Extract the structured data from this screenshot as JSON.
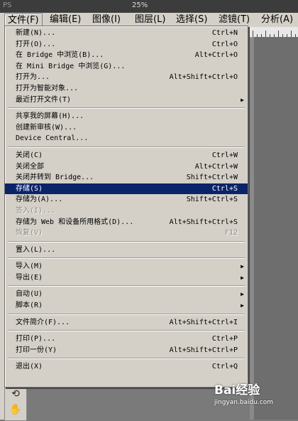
{
  "appbar": {
    "ps_logo": "PS",
    "zoom": "25%"
  },
  "menubar": {
    "items": [
      {
        "label": "文件(F)"
      },
      {
        "label": "编辑(E)"
      },
      {
        "label": "图像(I)"
      },
      {
        "label": "图层(L)"
      },
      {
        "label": "选择(S)"
      },
      {
        "label": "滤镜(T)"
      },
      {
        "label": "分析(A)"
      }
    ]
  },
  "file_menu": {
    "groups": [
      [
        {
          "label": "新建(N)...",
          "shortcut": "Ctrl+N"
        },
        {
          "label": "打开(O)...",
          "shortcut": "Ctrl+O"
        },
        {
          "label": "在 Bridge 中浏览(B)...",
          "shortcut": "Alt+Ctrl+O"
        },
        {
          "label": "在 Mini Bridge 中浏览(G)...",
          "shortcut": ""
        },
        {
          "label": "打开为...",
          "shortcut": "Alt+Shift+Ctrl+O"
        },
        {
          "label": "打开为智能对象...",
          "shortcut": ""
        },
        {
          "label": "最近打开文件(T)",
          "shortcut": "",
          "submenu": true
        }
      ],
      [
        {
          "label": "共享我的屏幕(H)...",
          "shortcut": ""
        },
        {
          "label": "创建新审核(W)...",
          "shortcut": ""
        },
        {
          "label": "Device Central...",
          "shortcut": ""
        }
      ],
      [
        {
          "label": "关闭(C)",
          "shortcut": "Ctrl+W"
        },
        {
          "label": "关闭全部",
          "shortcut": "Alt+Ctrl+W"
        },
        {
          "label": "关闭并转到 Bridge...",
          "shortcut": "Shift+Ctrl+W"
        },
        {
          "label": "存储(S)",
          "shortcut": "Ctrl+S",
          "selected": true
        },
        {
          "label": "存储为(A)...",
          "shortcut": "Shift+Ctrl+S"
        },
        {
          "label": "签入(I)...",
          "shortcut": "",
          "disabled": true
        },
        {
          "label": "存储为 Web 和设备所用格式(D)...",
          "shortcut": "Alt+Shift+Ctrl+S"
        },
        {
          "label": "恢复(V)",
          "shortcut": "F12",
          "disabled": true
        }
      ],
      [
        {
          "label": "置入(L)...",
          "shortcut": ""
        }
      ],
      [
        {
          "label": "导入(M)",
          "shortcut": "",
          "submenu": true
        },
        {
          "label": "导出(E)",
          "shortcut": "",
          "submenu": true
        }
      ],
      [
        {
          "label": "自动(U)",
          "shortcut": "",
          "submenu": true
        },
        {
          "label": "脚本(R)",
          "shortcut": "",
          "submenu": true
        }
      ],
      [
        {
          "label": "文件简介(F)...",
          "shortcut": "Alt+Shift+Ctrl+I"
        }
      ],
      [
        {
          "label": "打印(P)...",
          "shortcut": "Ctrl+P"
        },
        {
          "label": "打印一份(Y)",
          "shortcut": "Alt+Shift+Ctrl+P"
        }
      ],
      [
        {
          "label": "退出(X)",
          "shortcut": "Ctrl+Q"
        }
      ]
    ]
  },
  "watermark": {
    "brand": "Bai经验",
    "url": "jingyan.baidu.com"
  }
}
